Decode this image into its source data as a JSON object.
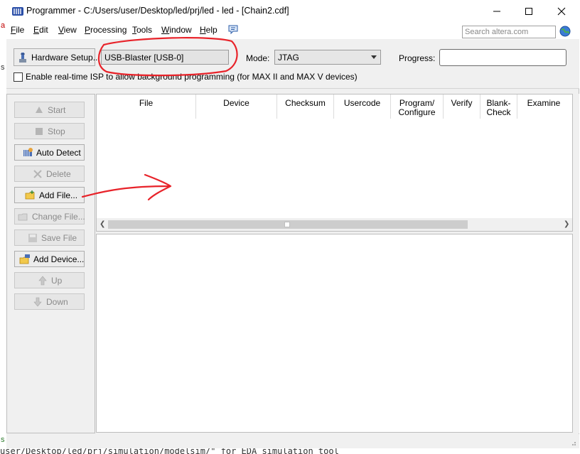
{
  "window": {
    "title": "Programmer - C:/Users/user/Desktop/led/prj/led - led - [Chain2.cdf]"
  },
  "menu": {
    "items": [
      {
        "first": "F",
        "rest": "ile"
      },
      {
        "first": "E",
        "rest": "dit"
      },
      {
        "first": "V",
        "rest": "iew"
      },
      {
        "first": "P",
        "rest": "rocessing"
      },
      {
        "first": "T",
        "rest": "ools"
      },
      {
        "first": "W",
        "rest": "indow"
      },
      {
        "first": "H",
        "rest": "elp"
      }
    ],
    "search_placeholder": "Search altera.com"
  },
  "toolbar": {
    "hardware_setup_label": "Hardware Setup...",
    "hardware_value": "USB-Blaster [USB-0]",
    "mode_label": "Mode:",
    "mode_value": "JTAG",
    "progress_label": "Progress:",
    "progress_fraction": 0,
    "isp_checkbox_label": "Enable real-time ISP to allow background programming (for MAX II and MAX V devices)",
    "isp_checked": false
  },
  "side_buttons": {
    "start": "Start",
    "stop": "Stop",
    "auto_detect": "Auto Detect",
    "delete": "Delete",
    "add_file": "Add File...",
    "change_file": "Change File...",
    "save_file": "Save File",
    "add_device": "Add Device...",
    "up": "Up",
    "down": "Down"
  },
  "table": {
    "columns": [
      {
        "l1": "File",
        "l2": ""
      },
      {
        "l1": "Device",
        "l2": ""
      },
      {
        "l1": "Checksum",
        "l2": ""
      },
      {
        "l1": "Usercode",
        "l2": ""
      },
      {
        "l1": "Program/",
        "l2": "Configure"
      },
      {
        "l1": "Verify",
        "l2": ""
      },
      {
        "l1": "Blank-",
        "l2": "Check"
      },
      {
        "l1": "Examine",
        "l2": ""
      }
    ]
  },
  "background": {
    "left_fragment_1": "a",
    "left_fragment_2": "s",
    "left_fragment_3": "s",
    "command_line": "user/Desktop/led/prj/simulation/modelsim/\" for EDA simulation tool"
  },
  "colors": {
    "annotation_red": "#e8232a",
    "progress_fill": "#06b025"
  }
}
